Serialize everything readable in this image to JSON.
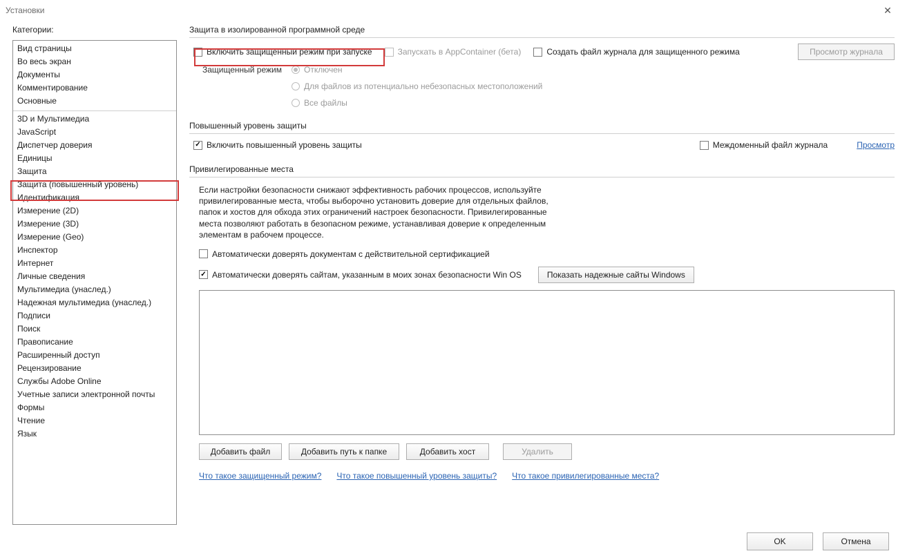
{
  "window": {
    "title": "Установки"
  },
  "sidebar": {
    "label": "Категории:",
    "groups": [
      [
        "Вид страницы",
        "Во весь экран",
        "Документы",
        "Комментирование",
        "Основные"
      ],
      [
        "3D и Мультимедиа",
        "JavaScript",
        "Диспетчер доверия",
        "Единицы",
        "Защита",
        "Защита (повышенный уровень)",
        "Идентификация",
        "Измерение (2D)",
        "Измерение (3D)",
        "Измерение (Geo)",
        "Инспектор",
        "Интернет",
        "Личные сведения",
        "Мультимедиа (унаслед.)",
        "Надежная мультимедиа (унаслед.)",
        "Подписи",
        "Поиск",
        "Правописание",
        "Расширенный доступ",
        "Рецензирование",
        "Службы Adobe Online",
        "Учетные записи электронной почты",
        "Формы",
        "Чтение",
        "Язык"
      ]
    ]
  },
  "sandbox": {
    "title": "Защита в изолированной программной среде",
    "enableProtected": "Включить защищенный режим при запуске",
    "appContainer": "Запускать в AppContainer (бета)",
    "createLog": "Создать файл журнала для защищенного режима",
    "viewLog": "Просмотр журнала",
    "modeLabel": "Защищенный режим",
    "opts": [
      "Отключен",
      "Для файлов из потенциально небезопасных местоположений",
      "Все файлы"
    ]
  },
  "enhanced": {
    "title": "Повышенный уровень защиты",
    "enable": "Включить повышенный уровень защиты",
    "crossDomainLog": "Междоменный файл журнала",
    "view": "Просмотр"
  },
  "priv": {
    "title": "Привилегированные места",
    "help": "Если настройки безопасности снижают эффективность рабочих процессов, используйте привилегированные места, чтобы выборочно установить доверие для отдельных файлов, папок и хостов для обхода этих ограничений настроек безопасности. Привилегированные места позволяют работать в безопасном режиме, устанавливая доверие к определенным элементам в рабочем процессе.",
    "autoTrustCert": "Автоматически доверять документам с действительной сертификацией",
    "autoTrustWin": "Автоматически доверять сайтам, указанным в моих зонах безопасности Win OS",
    "showTrusted": "Показать надежные сайты Windows",
    "addFile": "Добавить файл",
    "addFolder": "Добавить путь к папке",
    "addHost": "Добавить хост",
    "delete": "Удалить"
  },
  "links": {
    "protected": "Что такое защищенный режим?",
    "enhanced": "Что такое повышенный уровень защиты?",
    "priv": "Что такое привилегированные места?"
  },
  "footer": {
    "ok": "OK",
    "cancel": "Отмена"
  }
}
